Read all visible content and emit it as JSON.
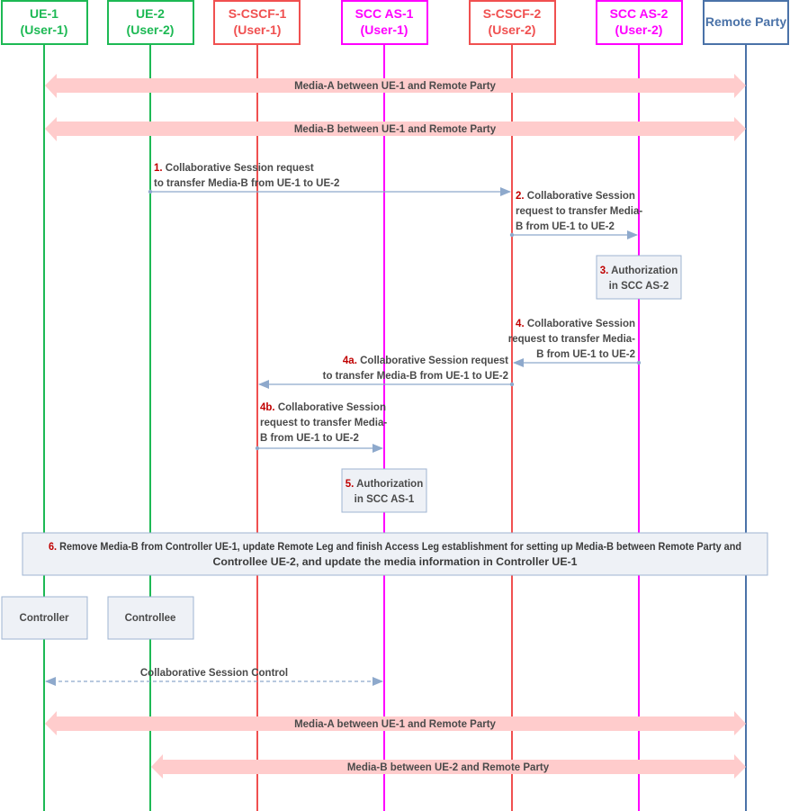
{
  "entities": [
    {
      "id": "ue1",
      "line1": "UE-1",
      "line2": "(User-1)",
      "color": "#1db954"
    },
    {
      "id": "ue2",
      "line1": "UE-2",
      "line2": "(User-2)",
      "color": "#1db954"
    },
    {
      "id": "scscf1",
      "line1": "S-CSCF-1",
      "line2": "(User-1)",
      "color": "#f05050"
    },
    {
      "id": "sccas1",
      "line1": "SCC AS-1",
      "line2": "(User-1)",
      "color": "#ff00ff"
    },
    {
      "id": "scscf2",
      "line1": "S-CSCF-2",
      "line2": "(User-2)",
      "color": "#f05050"
    },
    {
      "id": "sccas2",
      "line1": "SCC AS-2",
      "line2": "(User-2)",
      "color": "#ff00ff"
    },
    {
      "id": "remote",
      "line1": "Remote Party",
      "line2": "",
      "color": "#4a72a8"
    }
  ],
  "media_flows": [
    {
      "id": "media-a-top",
      "label": "Media-A between UE-1 and Remote Party",
      "from": "ue1",
      "to": "remote"
    },
    {
      "id": "media-b-top",
      "label": "Media-B between UE-1 and Remote Party",
      "from": "ue1",
      "to": "remote"
    },
    {
      "id": "media-a-bottom",
      "label": "Media-A between UE-1 and Remote Party",
      "from": "ue1",
      "to": "remote"
    },
    {
      "id": "media-b-bottom",
      "label": "Media-B between UE-2 and Remote Party",
      "from": "ue2",
      "to": "remote"
    }
  ],
  "messages": [
    {
      "step": "1.",
      "lines": [
        "Collaborative Session request",
        "to transfer Media-B from UE-1 to UE-2"
      ],
      "from": "ue2",
      "to": "scscf2"
    },
    {
      "step": "2.",
      "lines": [
        "Collaborative Session",
        "request to transfer Media-",
        "B from UE-1 to UE-2"
      ],
      "from": "scscf2",
      "to": "sccas2"
    },
    {
      "step": "4.",
      "lines": [
        "Collaborative Session",
        "request to transfer Media-",
        "B from UE-1 to UE-2"
      ],
      "from": "sccas2",
      "to": "scscf2"
    },
    {
      "step": "4a.",
      "lines": [
        "Collaborative Session request",
        "to transfer Media-B from UE-1 to UE-2"
      ],
      "from": "scscf2",
      "to": "scscf1"
    },
    {
      "step": "4b.",
      "lines": [
        "Collaborative Session",
        "request to transfer Media-",
        "B from UE-1 to UE-2"
      ],
      "from": "scscf1",
      "to": "sccas1"
    }
  ],
  "notes": [
    {
      "step": "3.",
      "lines": [
        "Authorization",
        "in SCC AS-2"
      ]
    },
    {
      "step": "5.",
      "lines": [
        "Authorization",
        "in SCC AS-1"
      ]
    },
    {
      "step": "6.",
      "lines": [
        "Remove Media-B from Controller UE-1, update Remote Leg and finish Access Leg establishment for setting up Media-B between Remote Party and",
        "Controllee UE-2, and update the media information in Controller UE-1"
      ]
    }
  ],
  "roles": [
    {
      "label": "Controller"
    },
    {
      "label": "Controllee"
    }
  ],
  "control": {
    "label": "Collaborative Session Control",
    "from": "ue1",
    "to": "sccas1",
    "style": "dashed-bidirectional"
  },
  "colors": {
    "ue": "#1db954",
    "scscf": "#f05050",
    "sccas": "#ff00ff",
    "remote": "#4a72a8",
    "media_arrow": "#ffcccc",
    "message_arrow": "#8ea9cc",
    "note_fill": "#eef1f6",
    "note_border": "#9fb4d2",
    "step_number": "#c00000"
  }
}
